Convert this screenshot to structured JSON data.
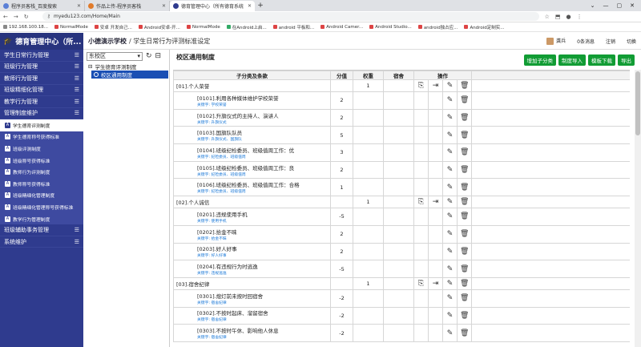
{
  "browser": {
    "tabs": [
      {
        "title": "程序员客栈_百度搜索",
        "active": false
      },
      {
        "title": "作品上传-程序员客栈",
        "active": false
      },
      {
        "title": "德育管理中心（所有德育系统",
        "active": true
      }
    ],
    "url": "myedu123.com/Home/Main",
    "bookmarks": [
      "192.168.100.18...",
      "NormalMode",
      "安卓 开发自己...",
      "Android安卓-开...",
      "NormalMode",
      "在Android上启...",
      "android 平板和...",
      "Android Camer...",
      "Android Studio...",
      "android独占应...",
      "Android定制实..."
    ]
  },
  "sidebar": {
    "brand": "德育管理中心（所...",
    "menu": [
      {
        "label": "学生日常行为管理"
      },
      {
        "label": "班级行为管理"
      },
      {
        "label": "教师行为管理"
      },
      {
        "label": "班级精细化管理"
      },
      {
        "label": "教学行为管理"
      },
      {
        "label": "管理制度维护"
      }
    ],
    "submenu": [
      {
        "label": "学生德育评测制度",
        "active": true
      },
      {
        "label": "学生德育称号获得标准"
      },
      {
        "label": "班级评测制度"
      },
      {
        "label": "班级称号获得标准"
      },
      {
        "label": "教师行为评测制度"
      },
      {
        "label": "教师称号获得标准"
      },
      {
        "label": "班级精细化管理制度"
      },
      {
        "label": "班级精细化管理称号获得标准"
      },
      {
        "label": "教学行为管理制度"
      }
    ],
    "menu_bottom": [
      {
        "label": "班级辅助事务管理"
      },
      {
        "label": "系统维护"
      }
    ]
  },
  "topbar": {
    "school": "小德演示学校",
    "crumb": "/ 学生日常行为评测标准设定",
    "user": "龚兵",
    "messages": "0条消息",
    "logout": "注销",
    "switch": "切换"
  },
  "tree": {
    "select_value": "东校区",
    "root": "学生德育评测制度",
    "child": "校区通用制度"
  },
  "main": {
    "title": "校区通用制度",
    "buttons": [
      "增加子分类",
      "制度导入",
      "模板下载",
      "导出"
    ],
    "headers": [
      "子分类及条款",
      "分值",
      "权重",
      "宿舍",
      "操作"
    ],
    "rows": [
      {
        "type": "group",
        "name": "[01].个人荣誉",
        "weight": "1"
      },
      {
        "type": "rule",
        "name": "[0101].利用各种媒体维护学校荣誉",
        "kw": "关键字: 学校荣誉",
        "score": "2"
      },
      {
        "type": "rule",
        "name": "[0102].升旗仪式的主持人、演讲人",
        "kw": "关键字: 升旗仪式",
        "score": "2"
      },
      {
        "type": "rule",
        "name": "[0103].国旗队队员",
        "kw": "关键字: 升旗仪式、国旗队",
        "score": "5"
      },
      {
        "type": "rule",
        "name": "[0104].班级纪检委员、班级值周工作：优",
        "kw": "关键字: 纪检委员、班级值周",
        "score": "3"
      },
      {
        "type": "rule",
        "name": "[0105].班级纪检委员、班级值周工作：良",
        "kw": "关键字: 纪检委员、班级值周",
        "score": "2"
      },
      {
        "type": "rule",
        "name": "[0106].班级纪检委员、班级值周工作：合格",
        "kw": "关键字: 纪检委员、班级值周",
        "score": "1"
      },
      {
        "type": "group",
        "name": "[02].个人诚信",
        "weight": "1"
      },
      {
        "type": "rule",
        "name": "[0201].违规使用手机",
        "kw": "关键字: 使用手机",
        "score": "-5"
      },
      {
        "type": "rule",
        "name": "[0202].拾金不昧",
        "kw": "关键字: 拾金不昧",
        "score": "2"
      },
      {
        "type": "rule",
        "name": "[0203].好人好事",
        "kw": "关键字: 好人好事",
        "score": "2"
      },
      {
        "type": "rule",
        "name": "[0204].有违规行为时逃逸",
        "kw": "关键字: 违规逃逸",
        "score": "-5"
      },
      {
        "type": "group",
        "name": "[03].宿舍纪律",
        "weight": "1"
      },
      {
        "type": "rule",
        "name": "[0301].熄灯前未按时回宿舍",
        "kw": "关键字: 宿舍纪律",
        "score": "-2"
      },
      {
        "type": "rule",
        "name": "[0302].不按时起床、溜留宿舍",
        "kw": "关键字: 宿舍纪律",
        "score": "-2"
      },
      {
        "type": "rule",
        "name": "[0303].不按时午休、影响他人休息",
        "kw": "关键字: 宿舍纪律",
        "score": "-2"
      }
    ]
  }
}
